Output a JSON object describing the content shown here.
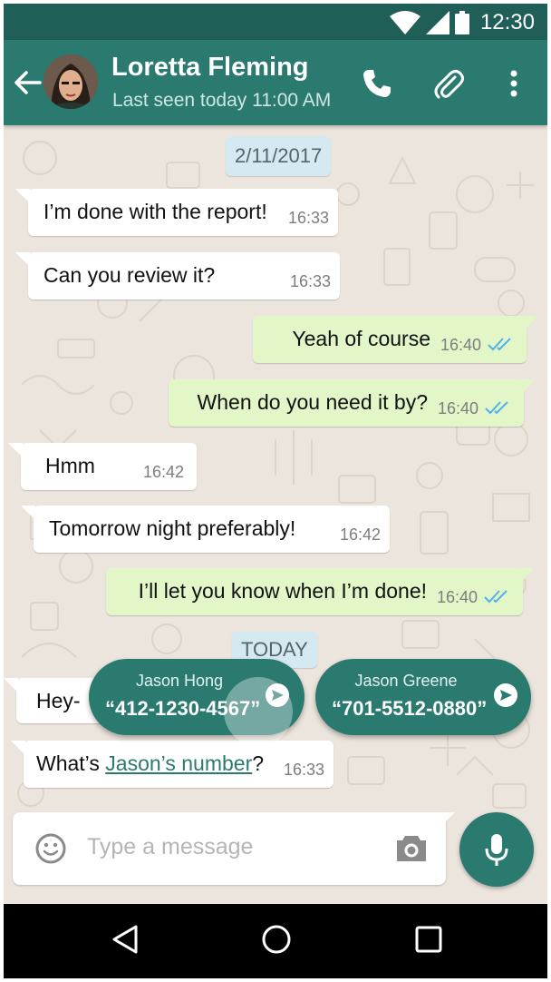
{
  "status_bar": {
    "time": "12:30"
  },
  "header": {
    "contact_name": "Loretta Fleming",
    "last_seen": "Last seen today 11:00 AM"
  },
  "dates": {
    "first": "2/11/2017",
    "today": "TODAY"
  },
  "messages": [
    {
      "text": "I’m done with the report!",
      "time": "16:33",
      "direction": "in"
    },
    {
      "text": "Can you review it?",
      "time": "16:33",
      "direction": "in"
    },
    {
      "text": "Yeah of course",
      "time": "16:40",
      "direction": "out",
      "read": true
    },
    {
      "text": "When do you need it by?",
      "time": "16:40",
      "direction": "out",
      "read": true
    },
    {
      "text": "Hmm",
      "time": "16:42",
      "direction": "in"
    },
    {
      "text": "Tomorrow night preferably!",
      "time": "16:42",
      "direction": "in"
    },
    {
      "text": "I’ll let you know when I’m done!",
      "time": "16:40",
      "direction": "out",
      "read": true
    },
    {
      "text": "Hey-",
      "direction": "in"
    },
    {
      "text_before": "What’s ",
      "link": "Jason’s number",
      "text_after": "?",
      "time": "16:33",
      "direction": "in"
    }
  ],
  "suggestions": [
    {
      "name": "Jason Hong",
      "number": "“412-1230-4567”"
    },
    {
      "name": "Jason Greene",
      "number": "“701-5512-0880”"
    }
  ],
  "composer": {
    "placeholder": "Type a message"
  },
  "icons": {
    "back": "arrow-left-icon",
    "call": "phone-icon",
    "attach": "paperclip-icon",
    "menu": "more-vert-icon",
    "emoji": "smiley-icon",
    "camera": "camera-icon",
    "mic": "microphone-icon",
    "nav": [
      "back-triangle-icon",
      "home-circle-icon",
      "recents-square-icon"
    ]
  },
  "colors": {
    "primary": "#2b7a70",
    "status_bar": "#1f5f58",
    "outgoing_bubble": "#e2f6c8",
    "incoming_bubble": "#ffffff",
    "chat_background": "#ece5dd",
    "date_chip": "#d5e9f2",
    "read_ticks": "#4fb3e8"
  }
}
